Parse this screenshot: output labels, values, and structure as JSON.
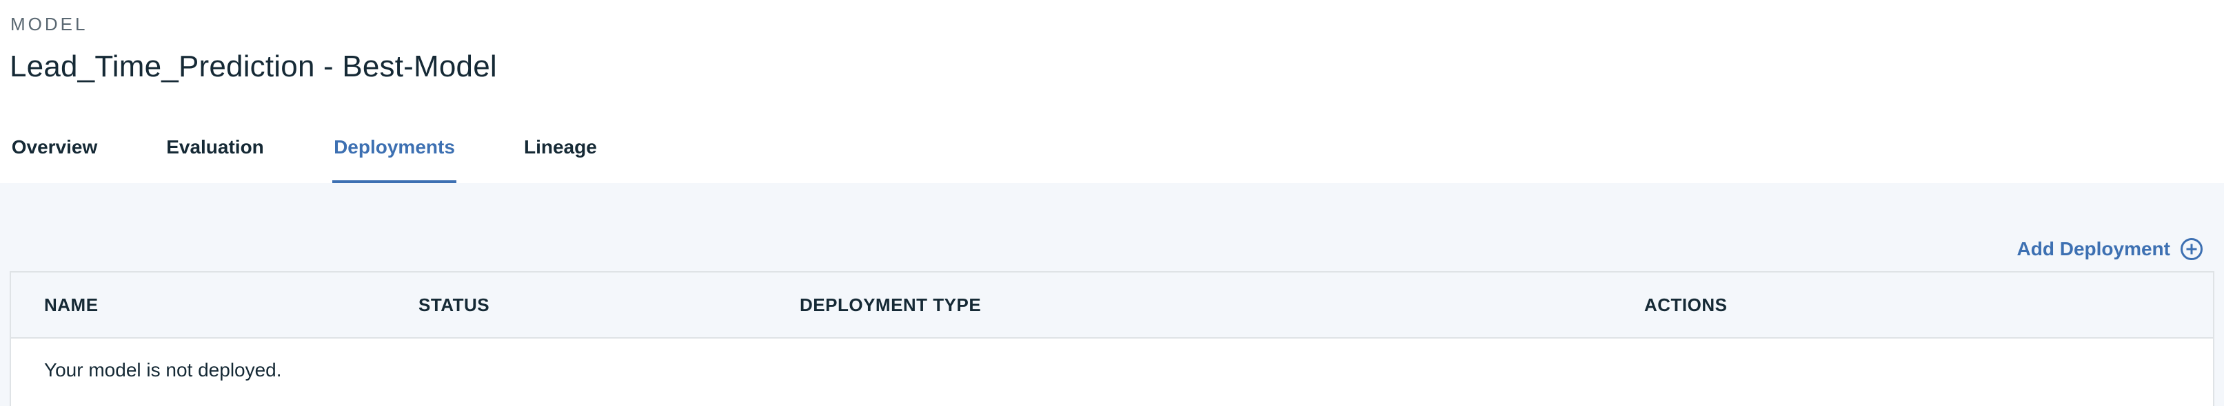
{
  "header": {
    "eyebrow": "MODEL",
    "title": "Lead_Time_Prediction - Best-Model"
  },
  "tabs": [
    {
      "label": "Overview",
      "active": false
    },
    {
      "label": "Evaluation",
      "active": false
    },
    {
      "label": "Deployments",
      "active": true
    },
    {
      "label": "Lineage",
      "active": false
    }
  ],
  "deployments": {
    "add_label": "Add Deployment",
    "add_icon": "add-circle-icon",
    "columns": [
      "NAME",
      "STATUS",
      "DEPLOYMENT TYPE",
      "ACTIONS"
    ],
    "empty_message": "Your model is not deployed."
  },
  "colors": {
    "accent": "#3d70b2",
    "text": "#152935",
    "muted": "#5a6872",
    "content_bg": "#f4f7fb",
    "border": "#dfe3e6"
  }
}
